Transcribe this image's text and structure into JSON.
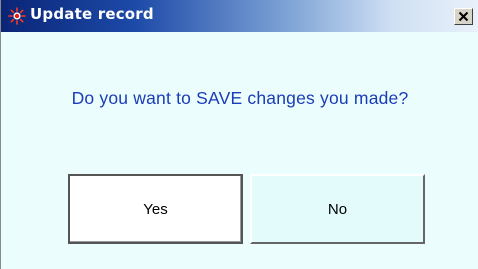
{
  "window": {
    "title": "Update record",
    "app_icon": "burst-icon",
    "close_icon": "close-x-icon"
  },
  "message": "Do you want to SAVE changes you made?",
  "buttons": {
    "yes_label": "Yes",
    "no_label": "No"
  },
  "colors": {
    "title_bar_start": "#0a2576",
    "title_bar_end": "#e9f1fa",
    "title_text": "#ffffff",
    "dialog_background": "#ecfdfd",
    "message_text": "#1a3cb8",
    "yes_button_background": "#ffffff",
    "no_button_background": "#e4fbfb"
  }
}
